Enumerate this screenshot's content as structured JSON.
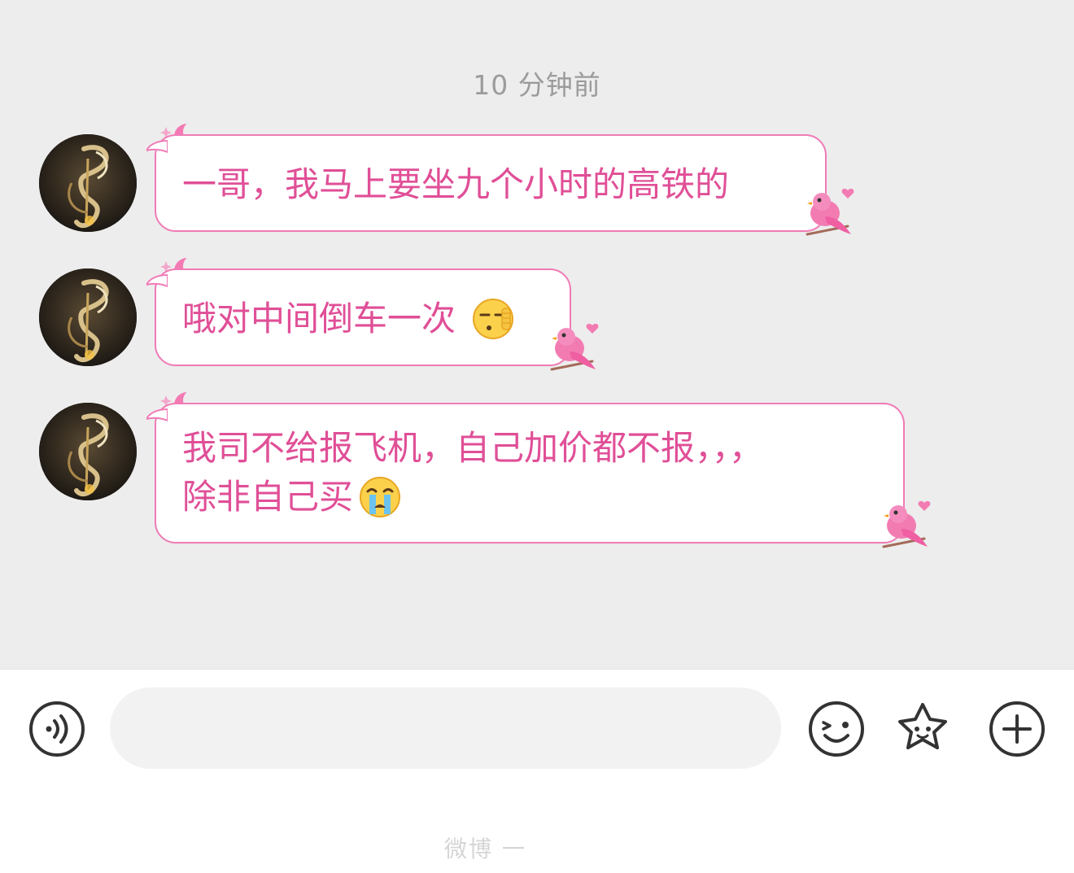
{
  "chat": {
    "timestamp": "10 分钟前",
    "messages": [
      {
        "text": "一哥，我马上要坐九个小时的高铁的",
        "emoji": ""
      },
      {
        "text": "哦对中间倒车一次",
        "emoji": "shush-face-emoji"
      },
      {
        "text": "我司不给报飞机，自己加价都不报，，，",
        "text2": "除非自己买",
        "emoji": "crying-face-emoji"
      }
    ],
    "avatar_icon": "dark-gold-swirl-avatar",
    "bubble_border_color": "#f07bb6",
    "bubble_text_color": "#e04f97"
  },
  "input_bar": {
    "placeholder": "",
    "voice_icon": "voice-wave-icon",
    "emoji_icon": "wink-face-icon",
    "sticker_icon": "star-face-icon",
    "more_icon": "plus-circle-icon"
  },
  "watermark": "微博 一"
}
